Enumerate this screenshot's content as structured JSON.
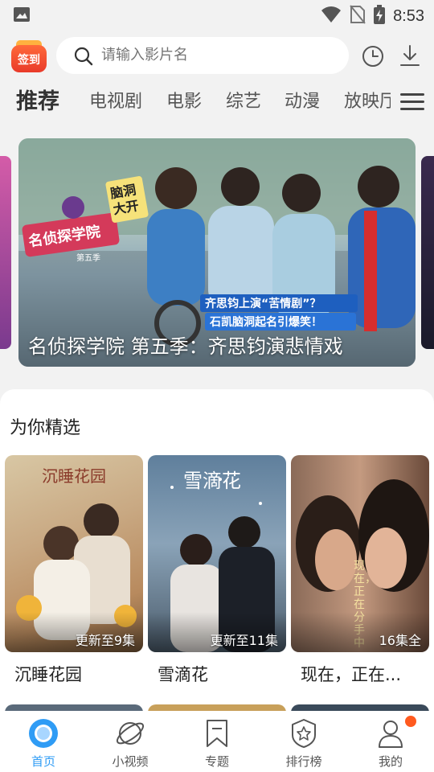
{
  "status_bar": {
    "time": "8:53"
  },
  "header": {
    "signin_label": "签到",
    "search_placeholder": "请输入影片名"
  },
  "tabs": [
    {
      "label": "推荐",
      "active": true
    },
    {
      "label": "电视剧",
      "active": false
    },
    {
      "label": "电影",
      "active": false
    },
    {
      "label": "综艺",
      "active": false
    },
    {
      "label": "动漫",
      "active": false
    },
    {
      "label": "放映厅",
      "active": false
    }
  ],
  "banner": {
    "title": "名侦探学院 第五季：齐思钧演悲情戏",
    "show_logo_text": "名侦探学院",
    "season_tag": "第五季",
    "sticker_text": "脑洞大开",
    "caption_line1": "齐思钧上演“苦情剧”？",
    "caption_line2": "石凯脑洞起名引爆笑！"
  },
  "picks": {
    "section_title": "为你精选",
    "items": [
      {
        "title": "沉睡花园",
        "badge": "更新至9集",
        "poster_text": "沉睡花园"
      },
      {
        "title": "雪滴花",
        "badge": "更新至11集",
        "poster_text": "雪滴花"
      },
      {
        "title": "现在，正在...",
        "badge": "16集全",
        "poster_text": "现在，正在分手中"
      }
    ]
  },
  "bottom_nav": [
    {
      "label": "首页",
      "icon": "home-icon",
      "active": true
    },
    {
      "label": "小视频",
      "icon": "planet-icon",
      "active": false
    },
    {
      "label": "专题",
      "icon": "bookmark-icon",
      "active": false
    },
    {
      "label": "排行榜",
      "icon": "star-shield-icon",
      "active": false
    },
    {
      "label": "我的",
      "icon": "person-icon",
      "active": false
    }
  ],
  "colors": {
    "accent": "#2f9cf5",
    "notification": "#ff5a1f",
    "signin": "#e93a2a"
  }
}
